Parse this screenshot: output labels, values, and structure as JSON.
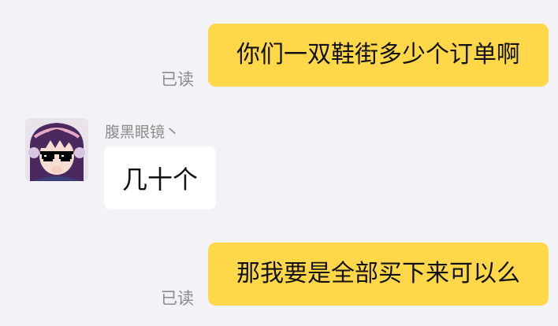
{
  "messages": [
    {
      "direction": "outgoing",
      "text": "你们一双鞋街多少个订单啊",
      "status": "已读"
    },
    {
      "direction": "incoming",
      "sender": "腹黑眼镜丶",
      "text": "几十个",
      "avatar_icon": "anime-girl-sunglasses-avatar"
    },
    {
      "direction": "outgoing",
      "text": "那我要是全部买下来可以么",
      "status": "已读"
    }
  ],
  "colors": {
    "background": "#f2f2f7",
    "outgoing_bubble": "#ffd84a",
    "incoming_bubble": "#ffffff",
    "status_text": "#8c8c8c"
  }
}
